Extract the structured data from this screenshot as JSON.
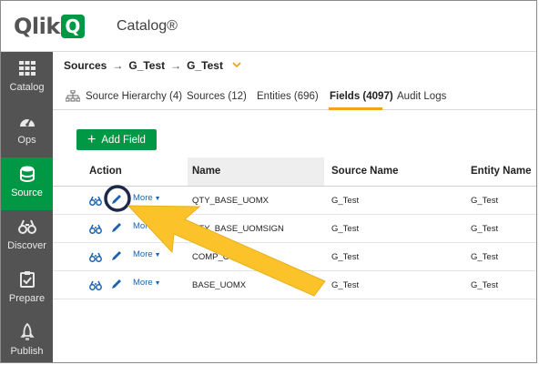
{
  "header": {
    "logo_text": "Qlik",
    "logo_mark": "Q",
    "app_title": "Catalog®"
  },
  "sidebar": {
    "items": [
      {
        "label": "Catalog",
        "icon": "grid-icon",
        "active": false
      },
      {
        "label": "Ops",
        "icon": "gauge-icon",
        "active": false
      },
      {
        "label": "Source",
        "icon": "database-icon",
        "active": true
      },
      {
        "label": "Discover",
        "icon": "binoculars-icon",
        "active": false
      },
      {
        "label": "Prepare",
        "icon": "clipboard-icon",
        "active": false
      },
      {
        "label": "Publish",
        "icon": "rocket-icon",
        "active": false
      }
    ]
  },
  "breadcrumb": {
    "items": [
      "Sources",
      "G_Test",
      "G_Test"
    ],
    "separator": "→"
  },
  "tabs": [
    {
      "label": "Source Hierarchy (4)",
      "active": false
    },
    {
      "label": "Sources (12)",
      "active": false
    },
    {
      "label": "Entities (696)",
      "active": false
    },
    {
      "label": "Fields (4097)",
      "active": true
    },
    {
      "label": "Audit Logs",
      "active": false
    }
  ],
  "toolbar": {
    "add_field_label": "Add Field"
  },
  "table": {
    "columns": [
      "Action",
      "Name",
      "Source Name",
      "Entity Name"
    ],
    "more_label": "More",
    "rows": [
      {
        "name": "QTY_BASE_UOMX",
        "source": "G_Test",
        "entity": "G_Test"
      },
      {
        "name": "QTY_BASE_UOMSIGN",
        "source": "G_Test",
        "entity": "G_Test"
      },
      {
        "name": "COMP_CODE",
        "source": "G_Test",
        "entity": "G_Test"
      },
      {
        "name": "BASE_UOMX",
        "source": "G_Test",
        "entity": "G_Test"
      }
    ]
  },
  "colors": {
    "brand_green": "#009845",
    "sidebar_bg": "#535353",
    "accent_orange": "#f2a21b",
    "link_blue": "#1b63b2",
    "annotation_arrow": "#fcc22a",
    "annotation_circle": "#1b2a4a"
  }
}
